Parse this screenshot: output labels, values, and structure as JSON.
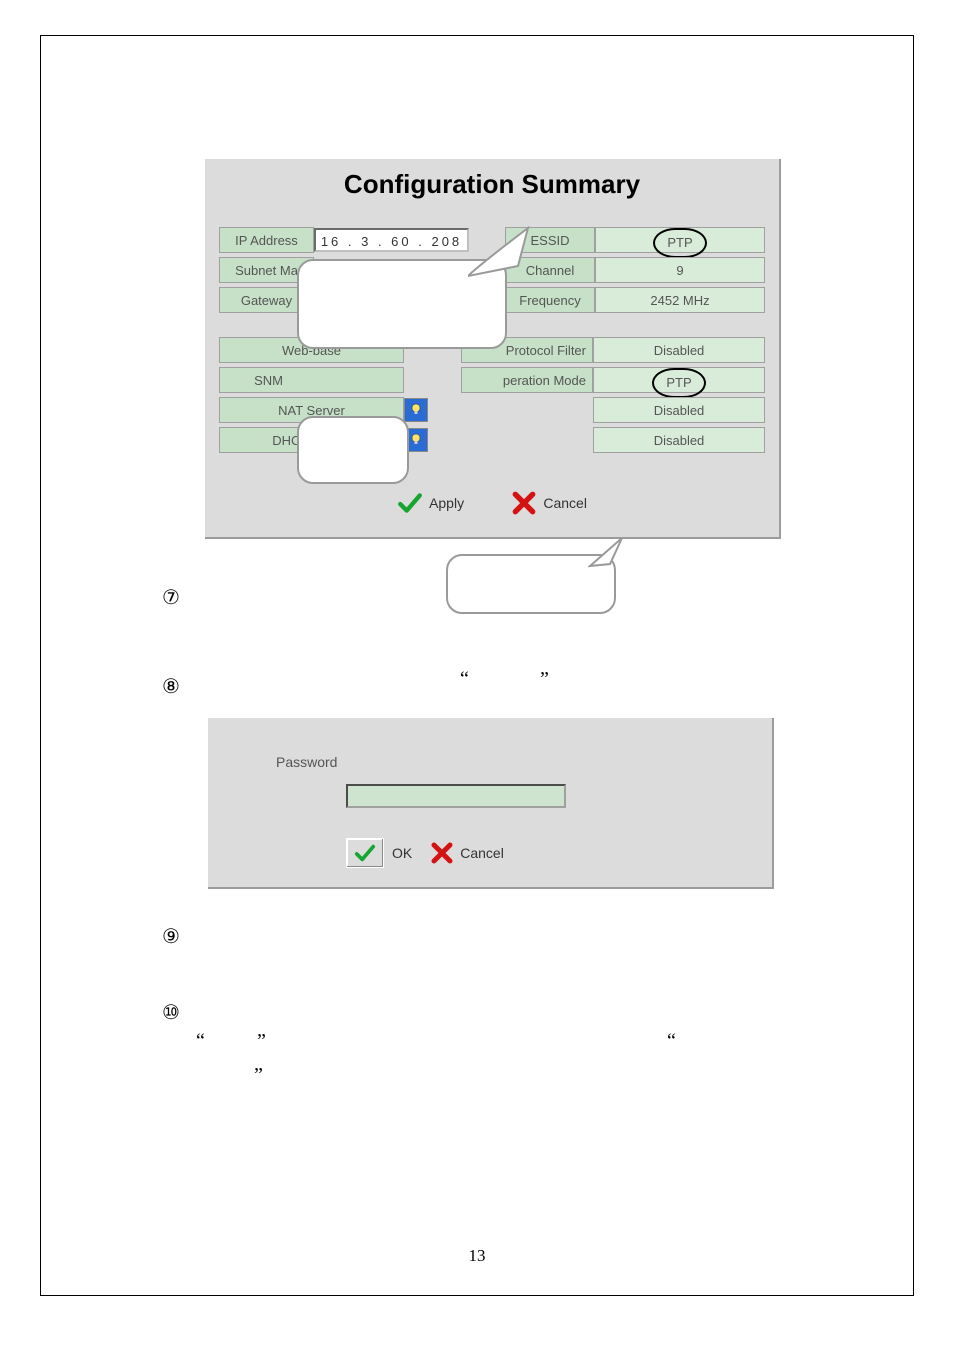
{
  "page_number": "13",
  "cfg": {
    "title": "Configuration Summary",
    "left_rows": [
      {
        "label": "IP Address",
        "value": "16  .  3  .  60  . 208",
        "value_is_input": true
      },
      {
        "label": "Subnet Ma",
        "value": "",
        "value_is_input": false
      },
      {
        "label": "Gateway",
        "value": "",
        "value_is_input": false
      }
    ],
    "right_rows": [
      {
        "label": "ESSID",
        "value": "PTP",
        "circled": true
      },
      {
        "label": "Channel",
        "value": "9",
        "circled": false
      },
      {
        "label": "Frequency",
        "value": "2452 MHz",
        "circled": false
      }
    ],
    "status_rows_left": [
      {
        "label": "Web-base"
      },
      {
        "label": "SNM"
      },
      {
        "label": "NAT Server",
        "show_bulb": true
      },
      {
        "label": "DHCP Server",
        "show_bulb": true
      }
    ],
    "status_rows_right": [
      {
        "label": "Protocol Filter",
        "value": "Disabled",
        "circled": false
      },
      {
        "label": "peration Mode",
        "value": "PTP",
        "circled": true
      },
      {
        "label": "",
        "value": "Disabled",
        "circled": false
      },
      {
        "label": "",
        "value": "Disabled",
        "circled": false
      }
    ],
    "apply_label": "Apply",
    "cancel_label": "Cancel"
  },
  "pwd": {
    "label": "Password",
    "ok_label": "OK",
    "cancel_label": "Cancel"
  },
  "steps": {
    "s7": "⑦",
    "s8": "⑧",
    "s9": "⑨",
    "s10": "⑩"
  },
  "quotes": {
    "open": "“",
    "close": "”"
  }
}
